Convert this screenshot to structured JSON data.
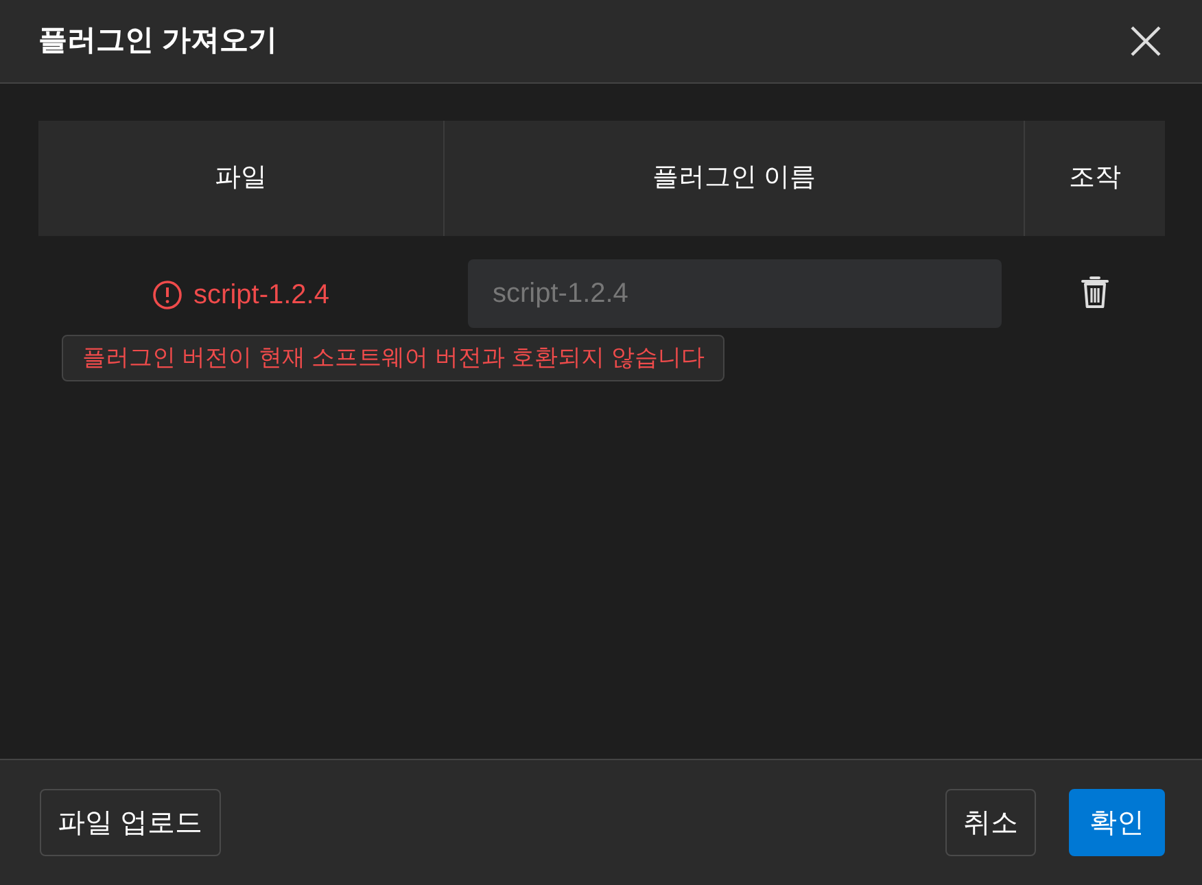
{
  "dialog": {
    "title": "플러그인 가져오기"
  },
  "table": {
    "columns": [
      "파일",
      "플러그인 이름",
      "조작"
    ],
    "rows": [
      {
        "file": "script-1.2.4",
        "error": true,
        "name_field": {
          "placeholder": "script-1.2.4"
        },
        "message": "플러그인 버전이 현재 소프트웨어 버전과 호환되지 않습니다"
      }
    ]
  },
  "footer": {
    "buttons": [
      {
        "label": "파일 업로드",
        "kind": "outline"
      },
      {
        "label": "취소",
        "kind": "outline"
      },
      {
        "label": "확인",
        "kind": "primary"
      }
    ]
  }
}
